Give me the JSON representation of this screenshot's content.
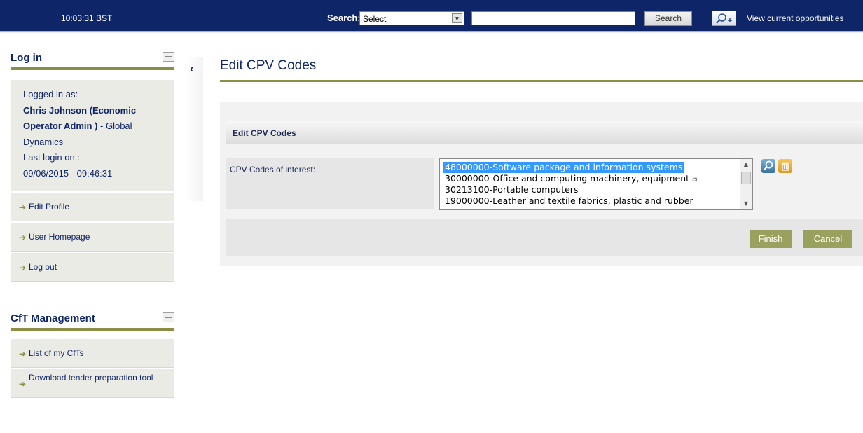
{
  "header": {
    "time": "10:03:31 BST",
    "search_label": "Search:",
    "search_select": "Select",
    "search_button": "Search",
    "view_link": "View current opportunities"
  },
  "login": {
    "title": "Log in",
    "logged_in_as": "Logged in as:",
    "user_bold": "Chris Johnson (Economic Operator Admin )",
    "org": " - Global Dynamics",
    "last_login_label": "Last login on :",
    "last_login_value": "09/06/2015 - 09:46:31",
    "menu": [
      {
        "label": "Edit Profile"
      },
      {
        "label": "User Homepage"
      },
      {
        "label": "Log out"
      }
    ]
  },
  "cft": {
    "title": "CfT Management",
    "menu": [
      {
        "label": "List of my CfTs"
      },
      {
        "label": "Download tender preparation tool"
      }
    ]
  },
  "main": {
    "page_title": "Edit CPV Codes",
    "section_title": "Edit CPV Codes",
    "field_label": "CPV Codes of interest:",
    "cpv_codes": [
      "48000000-Software package and information systems",
      "30000000-Office and computing machinery, equipment a",
      "30213100-Portable computers",
      "19000000-Leather and textile fabrics, plastic and rubber"
    ],
    "finish_button": "Finish",
    "cancel_button": "Cancel"
  },
  "colors": {
    "header_bg": "#0e2667",
    "accent_olive": "#8a8f45",
    "button_green": "#9aa05e",
    "selection_blue": "#3399ff"
  },
  "icons": [
    "magnifier-plus-icon",
    "collapse-icon",
    "chevron-left-icon",
    "arrow-right-icon",
    "lookup-icon",
    "trash-icon"
  ]
}
